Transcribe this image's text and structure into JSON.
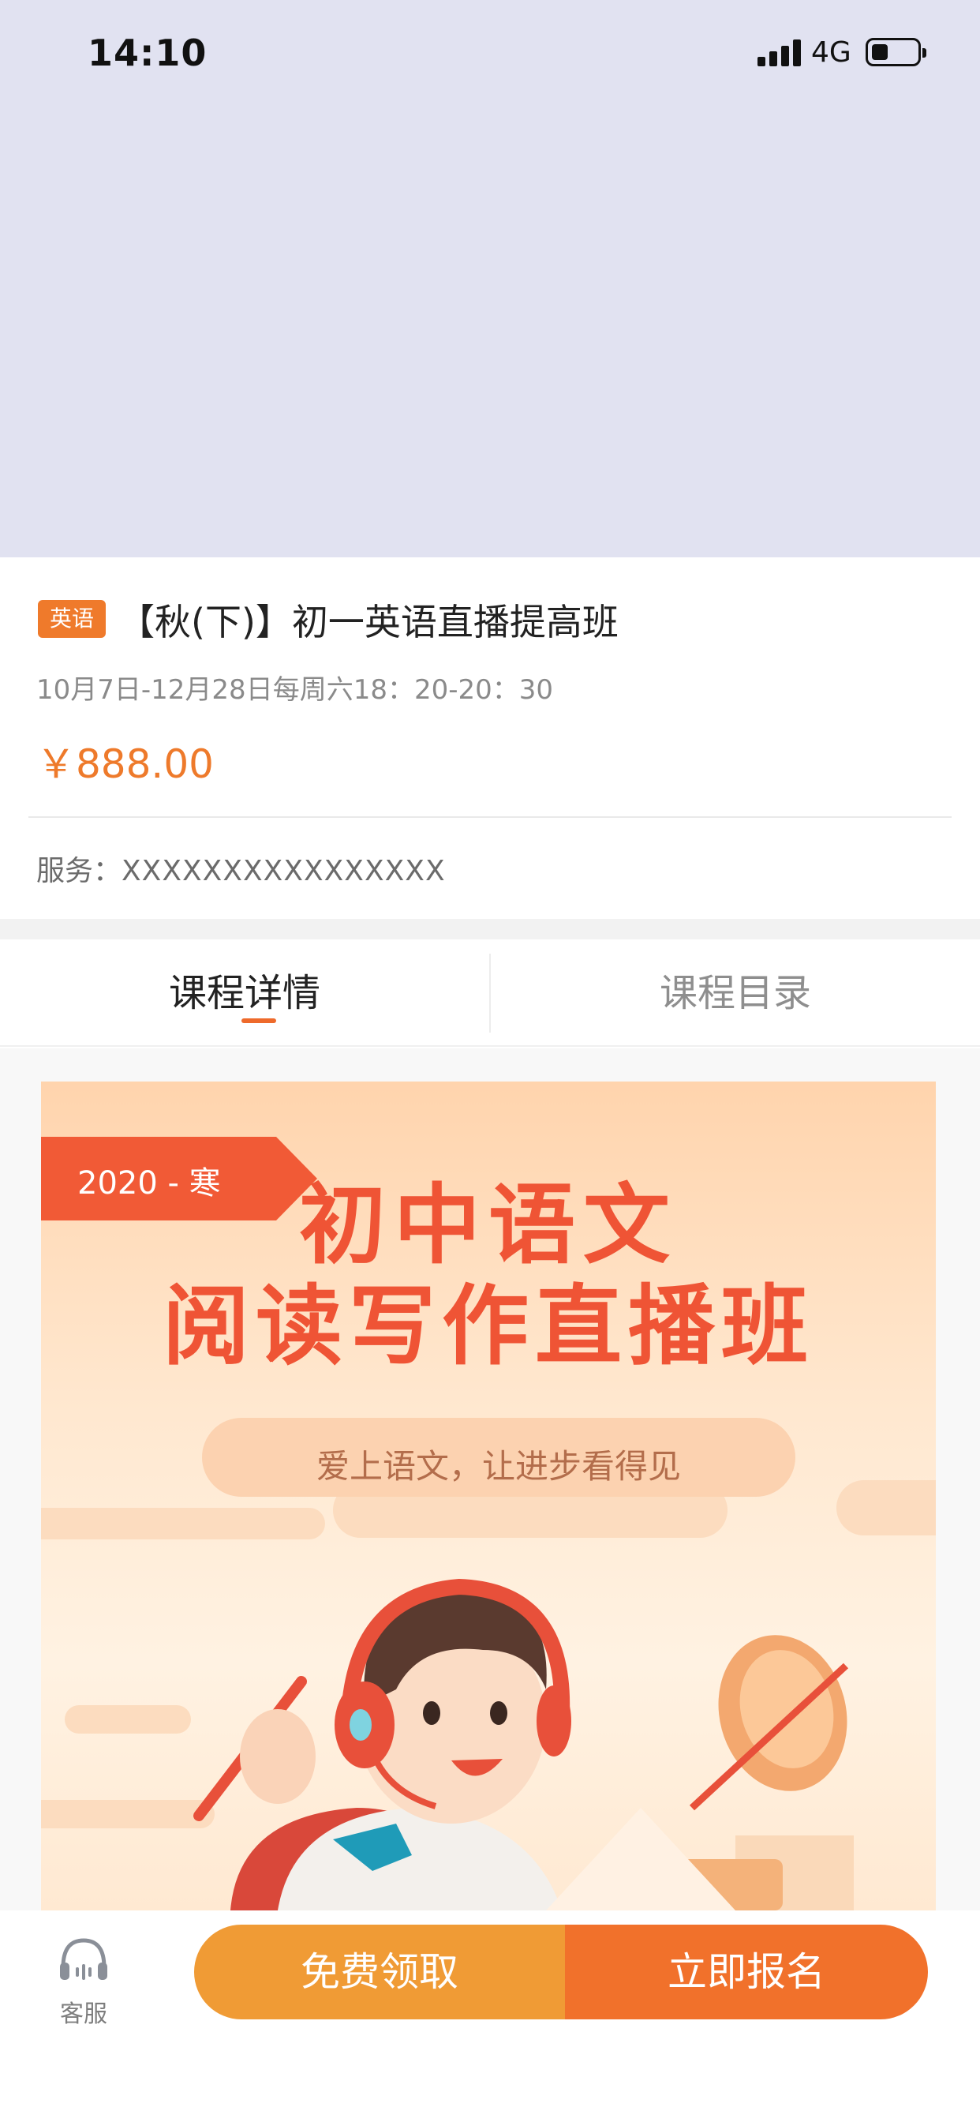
{
  "status_bar": {
    "time": "14:10",
    "network": "4G",
    "icons": [
      "signal-icon",
      "battery-icon"
    ]
  },
  "course": {
    "tag": "英语",
    "title": "【秋(下)】初一英语直播提高班",
    "schedule": "10月7日-12月28日每周六18：20-20：30",
    "price": "￥888.00",
    "service_label": "服务：",
    "service_value": "XXXXXXXXXXXXXXXX"
  },
  "tabs": [
    {
      "label": "课程详情",
      "active": true
    },
    {
      "label": "课程目录",
      "active": false
    }
  ],
  "banner": {
    "ribbon": "2020 - 寒",
    "title_line1": "初中语文",
    "title_line2": "阅读写作直播班",
    "slogan": "爱上语文，让进步看得见"
  },
  "bottom_bar": {
    "customer_service_label": "客服",
    "free_button": "免费领取",
    "enroll_button": "立即报名"
  },
  "colors": {
    "accent_orange": "#ef7a2b",
    "free_button": "#f09b35",
    "enroll_button": "#f1712b",
    "banner_title": "#ef5435",
    "hero_bg": "#e1e2f1"
  }
}
